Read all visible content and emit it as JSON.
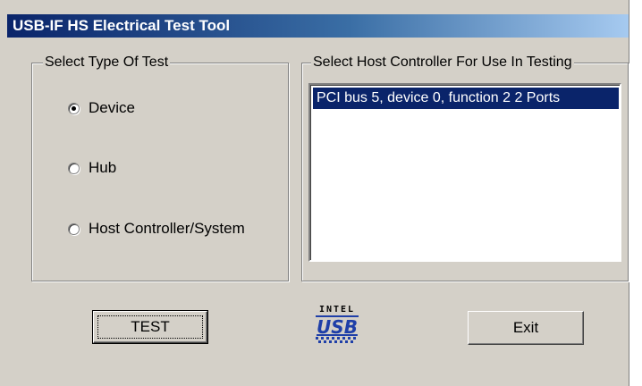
{
  "window": {
    "title": "USB-IF HS Electrical Test Tool"
  },
  "test_type": {
    "legend": "Select Type Of Test",
    "options": [
      {
        "label": "Device",
        "selected": true
      },
      {
        "label": "Hub",
        "selected": false
      },
      {
        "label": "Host Controller/System",
        "selected": false
      }
    ]
  },
  "host_controller": {
    "legend": "Select Host Controller For Use In Testing",
    "items": [
      {
        "label": "PCI bus 5, device 0, function 2  2 Ports",
        "selected": true
      }
    ]
  },
  "buttons": {
    "test_label": "TEST",
    "exit_label": "Exit"
  },
  "logo": {
    "top_text": "INTEL",
    "main_text": "USB",
    "colors": {
      "primary": "#1f3fa8",
      "text": "#000000"
    }
  },
  "colors": {
    "face": "#d4d0c8",
    "selection": "#0a246a",
    "title_start": "#0a246a",
    "title_end": "#a6caf0"
  }
}
